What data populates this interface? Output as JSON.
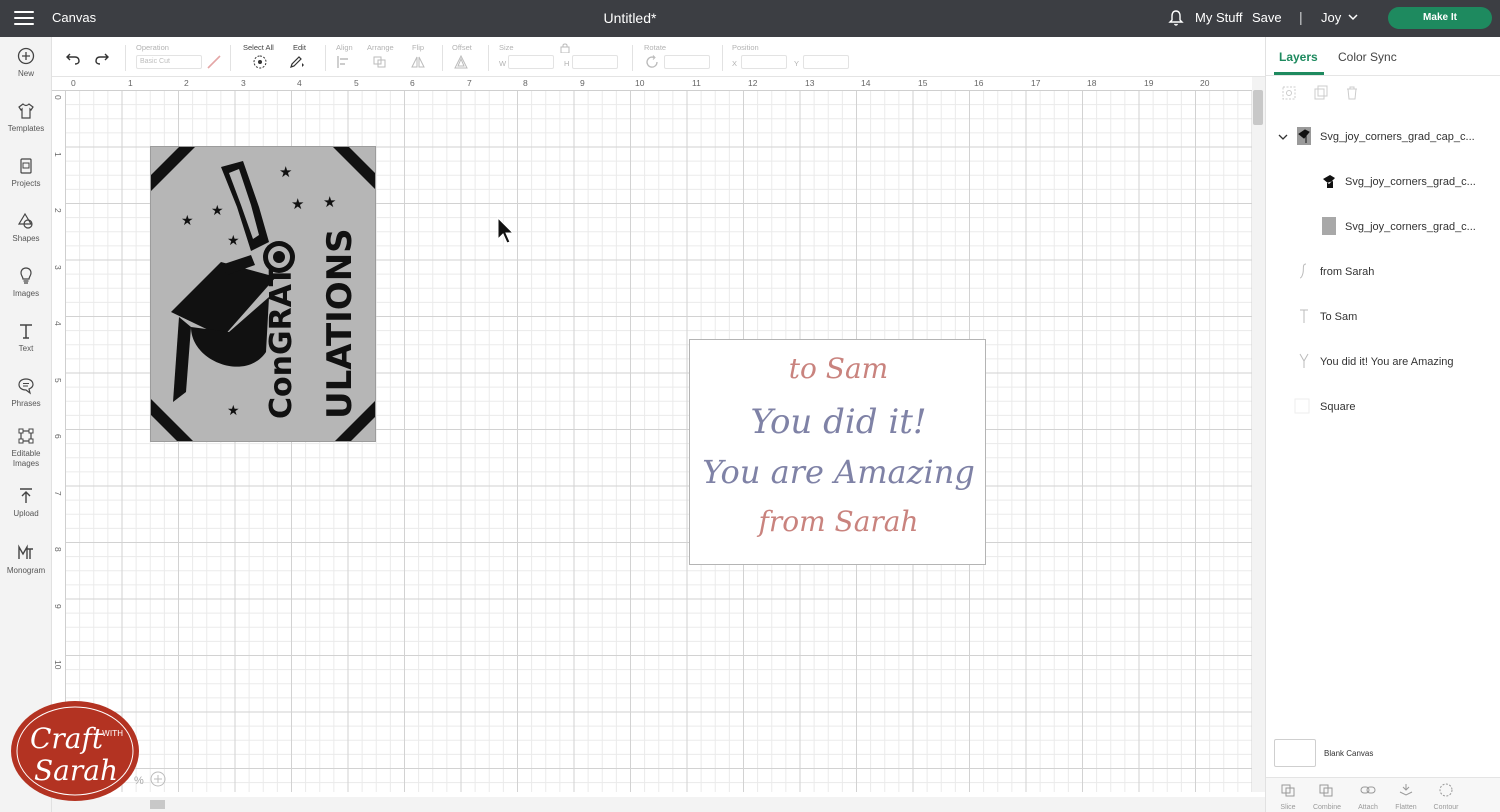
{
  "topbar": {
    "app_title": "Canvas",
    "document_title": "Untitled*",
    "my_stuff": "My Stuff",
    "save": "Save",
    "separator": "|",
    "user": "Joy",
    "make_it": "Make It"
  },
  "sidebar": {
    "items": [
      {
        "label": "New",
        "icon": "plus-circle-icon"
      },
      {
        "label": "Templates",
        "icon": "shirt-icon"
      },
      {
        "label": "Projects",
        "icon": "projects-icon"
      },
      {
        "label": "Shapes",
        "icon": "shapes-icon"
      },
      {
        "label": "Images",
        "icon": "lightbulb-icon"
      },
      {
        "label": "Text",
        "icon": "text-icon"
      },
      {
        "label": "Phrases",
        "icon": "speech-bubble-icon"
      },
      {
        "label": "Editable Images",
        "icon": "editable-images-icon"
      },
      {
        "label": "Upload",
        "icon": "upload-icon"
      },
      {
        "label": "Monogram",
        "icon": "monogram-icon"
      }
    ]
  },
  "toolbar": {
    "operation_label": "Operation",
    "operation_value": "Basic Cut",
    "select_all_label": "Select All",
    "edit_label": "Edit",
    "align_label": "Align",
    "arrange_label": "Arrange",
    "flip_label": "Flip",
    "offset_label": "Offset",
    "size_label": "Size",
    "width_prefix": "W",
    "height_prefix": "H",
    "rotate_label": "Rotate",
    "position_label": "Position",
    "x_prefix": "X",
    "y_prefix": "Y"
  },
  "rulers": {
    "horizontal": [
      "0",
      "1",
      "2",
      "3",
      "4",
      "5",
      "6",
      "7",
      "8",
      "9",
      "10",
      "11",
      "12",
      "13",
      "14",
      "15",
      "16",
      "17",
      "18",
      "19",
      "20"
    ],
    "vertical": [
      "0",
      "1",
      "2",
      "3",
      "4",
      "5",
      "6",
      "7",
      "8",
      "9",
      "10"
    ]
  },
  "canvas": {
    "note_card": {
      "line1": "to Sam",
      "line2": "You did it!",
      "line3": "You are Amazing",
      "line4": "from Sarah"
    },
    "grad_card": {
      "text_top": "ConGRAT",
      "text_bottom": "ULATIONS"
    }
  },
  "layers_panel": {
    "tabs": [
      {
        "label": "Layers",
        "active": true
      },
      {
        "label": "Color Sync",
        "active": false
      }
    ],
    "layers": [
      {
        "label": "Svg_joy_corners_grad_cap_c...",
        "type": "group"
      },
      {
        "label": "Svg_joy_corners_grad_c...",
        "type": "image"
      },
      {
        "label": "Svg_joy_corners_grad_c...",
        "type": "shape"
      },
      {
        "label": "from Sarah",
        "type": "text"
      },
      {
        "label": "To Sam",
        "type": "text"
      },
      {
        "label": "You did it! You are Amazing",
        "type": "text"
      },
      {
        "label": "Square",
        "type": "shape"
      }
    ],
    "blank_canvas": "Blank Canvas",
    "bottom_tools": [
      "Slice",
      "Combine",
      "Attach",
      "Flatten",
      "Contour"
    ]
  },
  "logo": {
    "word1": "Craft",
    "word2": "WITH",
    "word3": "Sarah"
  },
  "zoom": {
    "value": "%"
  },
  "colors": {
    "topbar": "#3c3e43",
    "accent": "#1e8a5f",
    "note_pink": "#c9837e",
    "note_blue": "#7f82a6",
    "logo_red": "#b33322"
  }
}
